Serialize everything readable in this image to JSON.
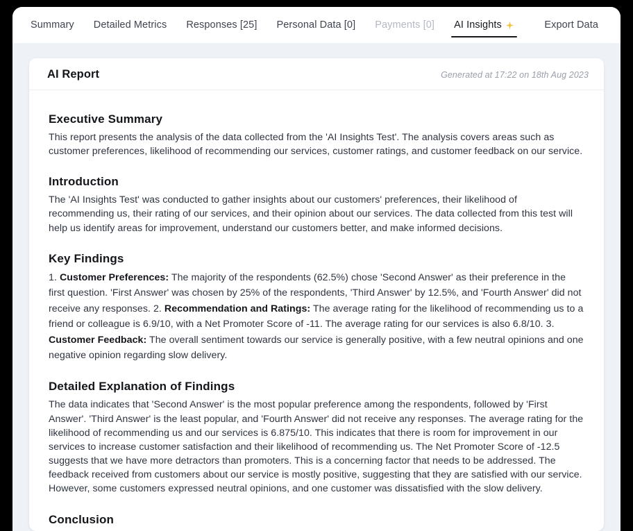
{
  "tabs": {
    "left": [
      {
        "label": "Summary",
        "state": "normal"
      },
      {
        "label": "Detailed Metrics",
        "state": "normal"
      },
      {
        "label": "Responses [25]",
        "state": "normal"
      },
      {
        "label": "Personal Data [0]",
        "state": "normal"
      },
      {
        "label": "Payments [0]",
        "state": "muted"
      },
      {
        "label": "AI Insights",
        "state": "active",
        "icon": "sparkle-icon"
      }
    ],
    "right": [
      {
        "label": "Export Data",
        "state": "normal"
      }
    ]
  },
  "card": {
    "title": "AI Report",
    "meta": "Generated at 17:22 on 18th Aug 2023"
  },
  "report": {
    "executive_summary": {
      "heading": "Executive Summary",
      "body": "This report presents the analysis of the data collected from the 'AI Insights Test'. The analysis covers areas such as customer preferences, likelihood of recommending our services, customer ratings, and customer feedback on our service."
    },
    "introduction": {
      "heading": "Introduction",
      "body": "The 'AI Insights Test' was conducted to gather insights about our customers' preferences, their likelihood of recommending us, their rating of our services, and their opinion about our services. The data collected from this test will help us identify areas for improvement, understand our customers better, and make informed decisions."
    },
    "key_findings": {
      "heading": "Key Findings",
      "item1_number": "1. ",
      "item1_label": "Customer Preferences:",
      "item1_text": " The majority of the respondents (62.5%) chose 'Second Answer' as their preference in the first question. 'First Answer' was chosen by 25% of the respondents, 'Third Answer' by 12.5%, and 'Fourth Answer' did not receive any responses. 2. ",
      "item2_label": "Recommendation and Ratings:",
      "item2_text": " The average rating for the likelihood of recommending us to a friend or colleague is 6.9/10, with a Net Promoter Score of -11. The average rating for our services is also 6.8/10. 3. ",
      "item3_label": "Customer Feedback:",
      "item3_text": " The overall sentiment towards our service is generally positive, with a few neutral opinions and one negative opinion regarding slow delivery."
    },
    "detailed_explanation": {
      "heading": "Detailed Explanation of Findings",
      "body": "The data indicates that 'Second Answer' is the most popular preference among the respondents, followed by 'First Answer'. 'Third Answer' is the least popular, and 'Fourth Answer' did not receive any responses. The average rating for the likelihood of recommending us and our services is 6.875/10. This indicates that there is room for improvement in our services to increase customer satisfaction and their likelihood of recommending us. The Net Promoter Score of -12.5 suggests that we have more detractors than promoters. This is a concerning factor that needs to be addressed. The feedback received from customers about our service is mostly positive, suggesting that they are satisfied with our service. However, some customers expressed neutral opinions, and one customer was dissatisfied with the slow delivery."
    },
    "conclusion": {
      "heading": "Conclusion"
    }
  },
  "colors": {
    "accent_sparkle": "#f0c23c",
    "active_tab_underline": "#14161b",
    "page_background": "#eef1f6",
    "card_background": "#ffffff"
  }
}
